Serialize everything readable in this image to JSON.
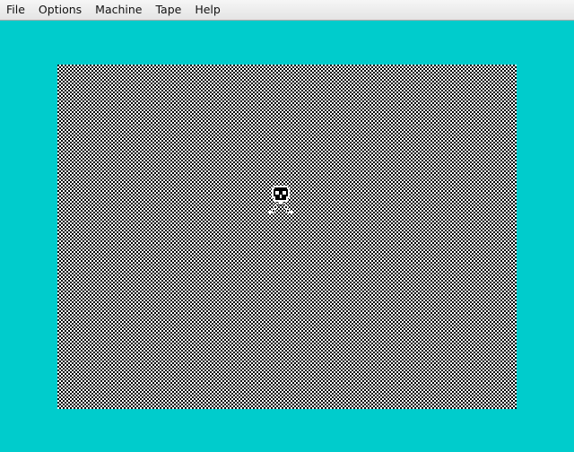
{
  "menubar": {
    "items": [
      {
        "label": "File"
      },
      {
        "label": "Options"
      },
      {
        "label": "Machine"
      },
      {
        "label": "Tape"
      },
      {
        "label": "Help"
      }
    ]
  },
  "emulator": {
    "border_color": "#00cccc",
    "screen_pattern_colors": [
      "#000000",
      "#ffffff"
    ],
    "sprite": {
      "icon": "skull-on-legs-icon",
      "colors": [
        "#000000",
        "#ffffff"
      ]
    }
  }
}
